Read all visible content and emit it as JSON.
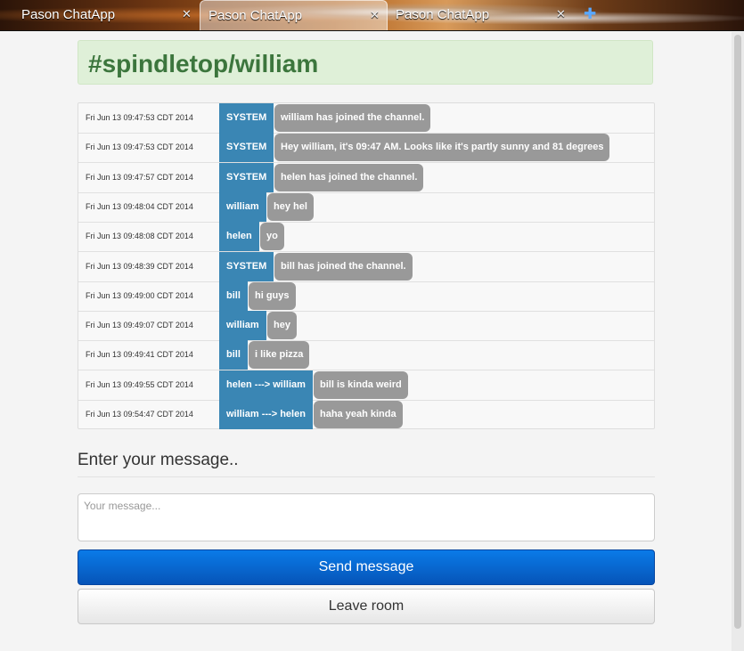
{
  "tabs": [
    {
      "label": "Pason ChatApp",
      "close": "✕"
    },
    {
      "label": "Pason ChatApp",
      "close": "✕"
    },
    {
      "label": "Pason ChatApp",
      "close": "✕"
    }
  ],
  "new_tab_icon": "plus-icon",
  "channel": {
    "title": "#spindletop/william"
  },
  "colors": {
    "sender_bg": "#3a86b4",
    "message_bg": "#999999",
    "header_bg": "#dff0d8",
    "header_text": "#3c763d",
    "send_button": "#0a6fd8"
  },
  "messages": [
    {
      "time": "Fri Jun 13 09:47:53 CDT 2014",
      "sender": "SYSTEM",
      "text": "william has joined the channel."
    },
    {
      "time": "Fri Jun 13 09:47:53 CDT 2014",
      "sender": "SYSTEM",
      "text": "Hey william, it's 09:47 AM. Looks like it's partly sunny and 81 degrees"
    },
    {
      "time": "Fri Jun 13 09:47:57 CDT 2014",
      "sender": "SYSTEM",
      "text": "helen has joined the channel."
    },
    {
      "time": "Fri Jun 13 09:48:04 CDT 2014",
      "sender": "william",
      "text": "hey hel"
    },
    {
      "time": "Fri Jun 13 09:48:08 CDT 2014",
      "sender": "helen",
      "text": "yo"
    },
    {
      "time": "Fri Jun 13 09:48:39 CDT 2014",
      "sender": "SYSTEM",
      "text": "bill has joined the channel."
    },
    {
      "time": "Fri Jun 13 09:49:00 CDT 2014",
      "sender": "bill",
      "text": "hi guys"
    },
    {
      "time": "Fri Jun 13 09:49:07 CDT 2014",
      "sender": "william",
      "text": "hey"
    },
    {
      "time": "Fri Jun 13 09:49:41 CDT 2014",
      "sender": "bill",
      "text": "i like pizza"
    },
    {
      "time": "Fri Jun 13 09:49:55 CDT 2014",
      "sender": "helen ---> william",
      "text": "bill is kinda weird"
    },
    {
      "time": "Fri Jun 13 09:54:47 CDT 2014",
      "sender": "william ---> helen",
      "text": "haha yeah kinda"
    }
  ],
  "compose": {
    "prompt": "Enter your message..",
    "placeholder": "Your message...",
    "value": "",
    "send_label": "Send message",
    "leave_label": "Leave room"
  }
}
